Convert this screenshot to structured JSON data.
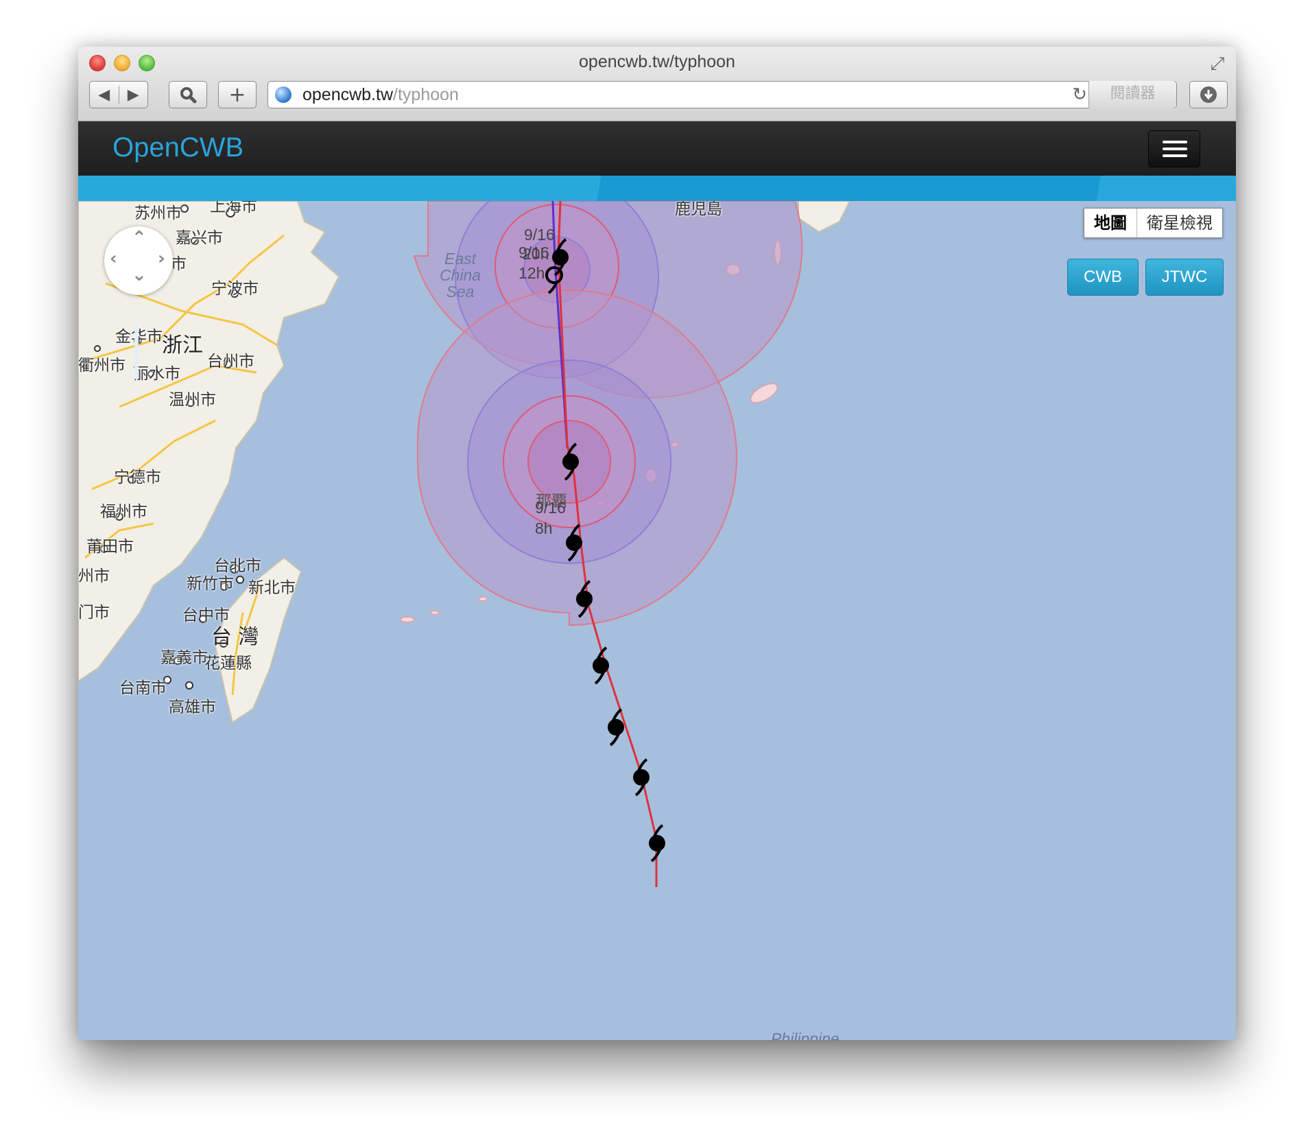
{
  "window": {
    "title": "opencwb.tw/typhoon",
    "url_host": "opencwb.tw",
    "url_path": "/typhoon",
    "reader_label": "閱讀器",
    "icons": [
      "back-icon",
      "forward-icon",
      "search-icon",
      "plus-icon",
      "globe-icon",
      "reload-icon",
      "download-icon",
      "fullscreen-icon"
    ]
  },
  "navbar": {
    "brand": "OpenCWB",
    "brand_color": "#29a3db",
    "menu_icon": "hamburger-icon"
  },
  "map": {
    "map_type": {
      "options": [
        "地圖",
        "衛星檢視"
      ],
      "selected": "地圖"
    },
    "sources": [
      "CWB",
      "JTWC"
    ],
    "source_button_color": "#2ea6d4",
    "track_colors": {
      "cwb": "#e0303a",
      "jtwc": "#5b2fc9"
    },
    "radius_colors": {
      "inner": "#e05a74",
      "outer": "#9a85d8"
    },
    "city_labels": {
      "suzhou": "苏州市",
      "shanghai": "上海市",
      "jiaxing": "嘉兴市",
      "hangzhou": "州市",
      "ningbo": "宁波市",
      "jinhua": "金华市",
      "zhejiang": "浙江",
      "quzhou": "衢州市",
      "taizhou": "台州市",
      "lishui": "丽水市",
      "wenzhou": "温州市",
      "ningde": "宁德市",
      "fuzhou": "福州市",
      "putian": "莆田市",
      "quanzhou": "州市",
      "xiamen": "门市",
      "taipei": "台北市",
      "hsinchu": "新竹市",
      "new_taipei": "新北市",
      "taichung": "台中市",
      "taiwan": "台 灣",
      "chiayi": "嘉義市",
      "hualien": "花蓮縣",
      "tainan": "台南市",
      "kaohsiung": "高雄市",
      "kagoshima": "鹿児島",
      "naha": "那覇",
      "philippines": "Philippine",
      "east_china_sea": "East China Sea"
    },
    "track_labels": {
      "a_date": "9/16",
      "a_hour": "20h",
      "b_date": "9/16",
      "b_hour": "12h",
      "c_date": "9/16",
      "c_hour": "8h"
    },
    "icons": [
      "pan-control-icon",
      "typhoon-icon"
    ]
  }
}
